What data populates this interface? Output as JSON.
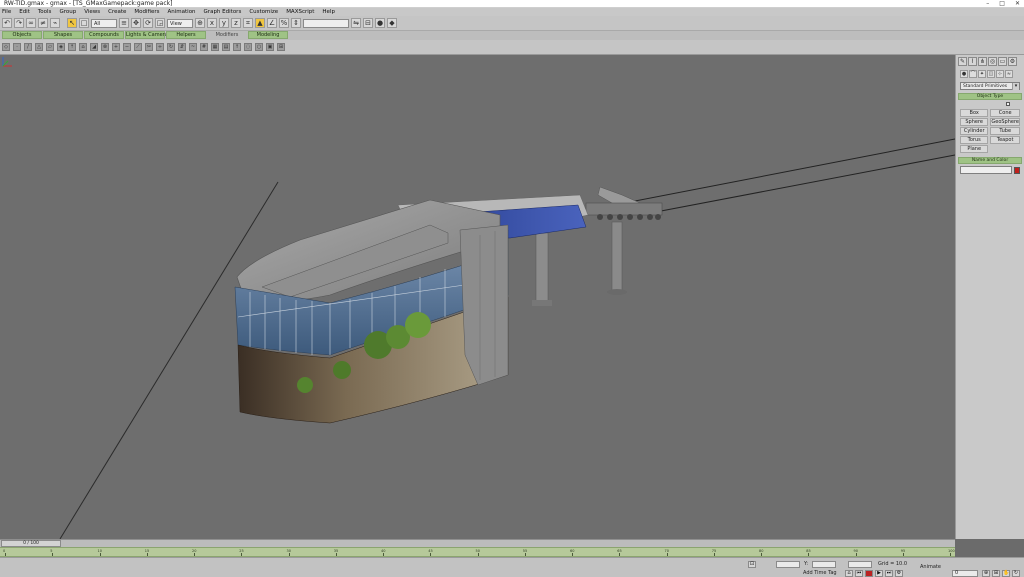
{
  "window": {
    "title": "RW-TID.gmax - gmax - [TS_GMaxGamepack:game pack]"
  },
  "menu": [
    "File",
    "Edit",
    "Tools",
    "Group",
    "Views",
    "Create",
    "Modifiers",
    "Animation",
    "Graph Editors",
    "Customize",
    "MAXScript",
    "Help"
  ],
  "toolbar": {
    "selection_filter": "All",
    "reference_coord": "View"
  },
  "tabs": [
    {
      "label": "Objects",
      "active": true
    },
    {
      "label": "Shapes",
      "active": true
    },
    {
      "label": "Compounds",
      "active": true
    },
    {
      "label": "Lights & Cameras",
      "active": true
    },
    {
      "label": "Helpers",
      "active": true
    },
    {
      "label": "Modifiers",
      "active": false
    },
    {
      "label": "Modeling",
      "active": true
    }
  ],
  "command_panel": {
    "dropdown": "Standard Primitives",
    "object_type_title": "Object Type",
    "autogrid_label": "AutoGrid",
    "primitives": [
      "Box",
      "Cone",
      "Sphere",
      "GeoSphere",
      "Cylinder",
      "Tube",
      "Torus",
      "Teapot",
      "Plane"
    ],
    "name_color_title": "Name and Color",
    "color": "#c0201c"
  },
  "timeline": {
    "slider": "0 / 100",
    "ticks": [
      "0",
      "5",
      "10",
      "15",
      "20",
      "25",
      "30",
      "35",
      "40",
      "45",
      "50",
      "55",
      "60",
      "65",
      "70",
      "75",
      "80",
      "85",
      "90",
      "95",
      "100"
    ]
  },
  "status": {
    "add_time_tag": "Add Time Tag",
    "grid": "Grid = 10.0",
    "animate": "Animate",
    "frame_value": "0",
    "x_label": "X:",
    "y_label": "Y:",
    "z_label": "Z:"
  },
  "colors": {
    "tab_green": "#9fc385",
    "viewport_bg": "#6e6e6e"
  }
}
